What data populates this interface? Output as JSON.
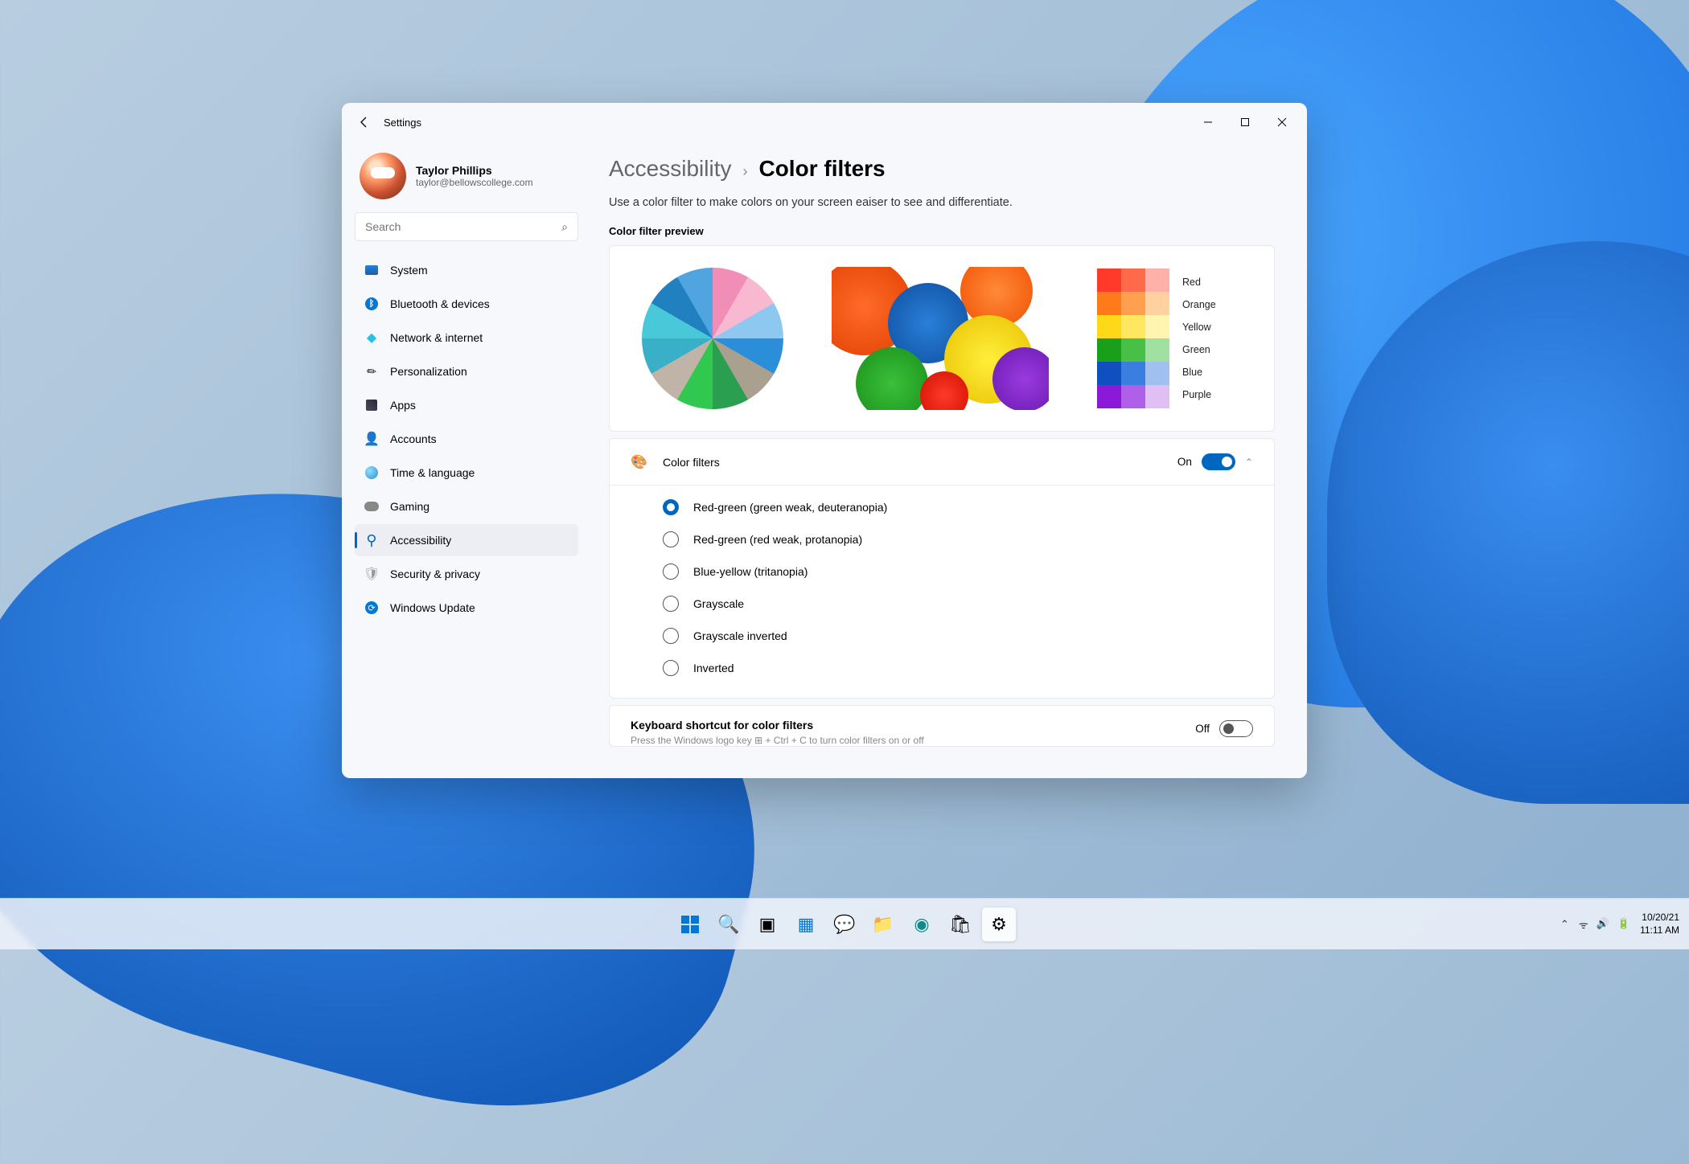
{
  "window": {
    "title": "Settings",
    "user": {
      "name": "Taylor Phillips",
      "email": "taylor@bellowscollege.com"
    },
    "search_placeholder": "Search"
  },
  "sidebar": {
    "items": [
      {
        "label": "System"
      },
      {
        "label": "Bluetooth & devices"
      },
      {
        "label": "Network & internet"
      },
      {
        "label": "Personalization"
      },
      {
        "label": "Apps"
      },
      {
        "label": "Accounts"
      },
      {
        "label": "Time & language"
      },
      {
        "label": "Gaming"
      },
      {
        "label": "Accessibility"
      },
      {
        "label": "Security & privacy"
      },
      {
        "label": "Windows Update"
      }
    ]
  },
  "breadcrumb": {
    "parent": "Accessibility",
    "sep": "›",
    "page": "Color filters"
  },
  "description": "Use a color filter to make colors on your screen eaiser to see and differentiate.",
  "preview": {
    "label": "Color filter preview",
    "swatch_labels": [
      "Red",
      "Orange",
      "Yellow",
      "Green",
      "Blue",
      "Purple"
    ],
    "swatch_colors": [
      [
        "#ff3a2a",
        "#ff6a4a",
        "#ffb0a8"
      ],
      [
        "#ff7a1a",
        "#ffa050",
        "#ffd0a0"
      ],
      [
        "#ffd81a",
        "#ffe860",
        "#fff4b0"
      ],
      [
        "#1a9f1a",
        "#48c048",
        "#a0e0a0"
      ],
      [
        "#104fc0",
        "#3a7fe0",
        "#a0c0f0"
      ],
      [
        "#8a1ad8",
        "#b060e8",
        "#e0c0f4"
      ]
    ]
  },
  "filter_row": {
    "title": "Color filters",
    "state_label": "On",
    "state": true
  },
  "filter_options": [
    {
      "label": "Red-green (green weak, deuteranopia)",
      "selected": true
    },
    {
      "label": "Red-green (red weak, protanopia)",
      "selected": false
    },
    {
      "label": "Blue-yellow (tritanopia)",
      "selected": false
    },
    {
      "label": "Grayscale",
      "selected": false
    },
    {
      "label": "Grayscale inverted",
      "selected": false
    },
    {
      "label": "Inverted",
      "selected": false
    }
  ],
  "shortcut": {
    "title": "Keyboard shortcut for color filters",
    "state_label": "Off",
    "state": false
  },
  "taskbar": {
    "date": "10/20/21",
    "time": "11:11 AM"
  }
}
